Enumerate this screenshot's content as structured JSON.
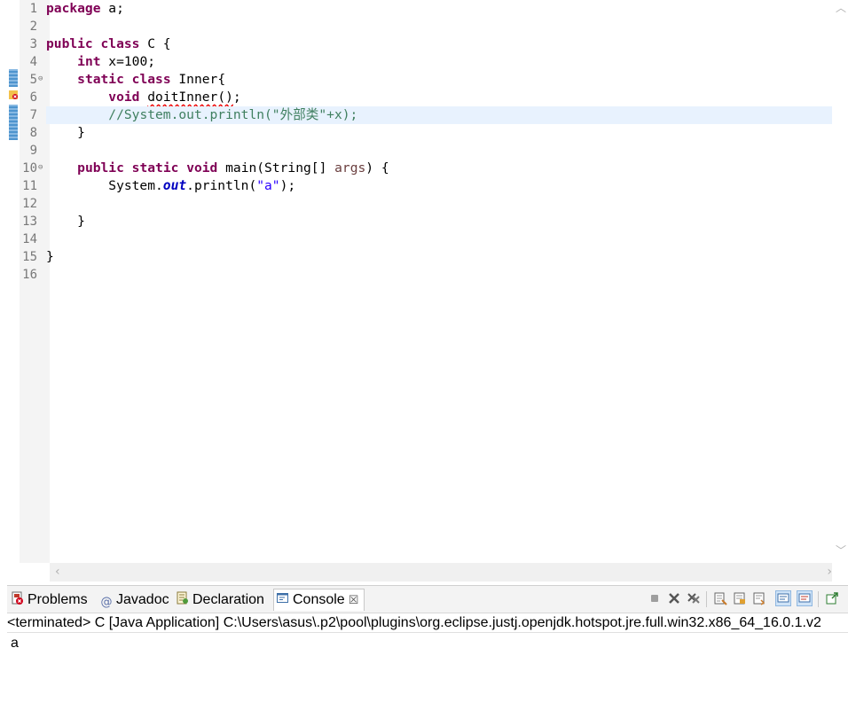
{
  "editor": {
    "lines": [
      {
        "n": "1",
        "tokens": [
          {
            "t": "package",
            "c": "kw"
          },
          {
            "t": " a;",
            "c": ""
          }
        ]
      },
      {
        "n": "2",
        "tokens": []
      },
      {
        "n": "3",
        "tokens": [
          {
            "t": "public",
            "c": "kw"
          },
          {
            "t": " ",
            "c": ""
          },
          {
            "t": "class",
            "c": "kw"
          },
          {
            "t": " C {",
            "c": ""
          }
        ]
      },
      {
        "n": "4",
        "tokens": [
          {
            "t": "    ",
            "c": ""
          },
          {
            "t": "int",
            "c": "kw"
          },
          {
            "t": " x=100;",
            "c": ""
          }
        ]
      },
      {
        "n": "5",
        "fold": true,
        "tokens": [
          {
            "t": "    ",
            "c": ""
          },
          {
            "t": "static",
            "c": "kw"
          },
          {
            "t": " ",
            "c": ""
          },
          {
            "t": "class",
            "c": "kw"
          },
          {
            "t": " Inner{",
            "c": ""
          }
        ]
      },
      {
        "n": "6",
        "tokens": [
          {
            "t": "        ",
            "c": ""
          },
          {
            "t": "void",
            "c": "kw"
          },
          {
            "t": " ",
            "c": ""
          },
          {
            "t": "doitInner()",
            "c": "err"
          },
          {
            "t": ";",
            "c": ""
          }
        ]
      },
      {
        "n": "7",
        "current": true,
        "tokens": [
          {
            "t": "        ",
            "c": ""
          },
          {
            "t": "//System.out.println(\"外部类\"+x);",
            "c": "cm"
          }
        ]
      },
      {
        "n": "8",
        "tokens": [
          {
            "t": "    }",
            "c": ""
          }
        ]
      },
      {
        "n": "9",
        "tokens": []
      },
      {
        "n": "10",
        "fold": true,
        "tokens": [
          {
            "t": "    ",
            "c": ""
          },
          {
            "t": "public",
            "c": "kw"
          },
          {
            "t": " ",
            "c": ""
          },
          {
            "t": "static",
            "c": "kw"
          },
          {
            "t": " ",
            "c": ""
          },
          {
            "t": "void",
            "c": "kw"
          },
          {
            "t": " main(String[] ",
            "c": ""
          },
          {
            "t": "args",
            "c": "var"
          },
          {
            "t": ") {",
            "c": ""
          }
        ]
      },
      {
        "n": "11",
        "tokens": [
          {
            "t": "        System.",
            "c": ""
          },
          {
            "t": "out",
            "c": "fld"
          },
          {
            "t": ".println(",
            "c": ""
          },
          {
            "t": "\"a\"",
            "c": "st"
          },
          {
            "t": ");",
            "c": ""
          }
        ]
      },
      {
        "n": "12",
        "tokens": []
      },
      {
        "n": "13",
        "tokens": [
          {
            "t": "    }",
            "c": ""
          }
        ]
      },
      {
        "n": "14",
        "tokens": []
      },
      {
        "n": "15",
        "tokens": [
          {
            "t": "}",
            "c": ""
          }
        ]
      },
      {
        "n": "16",
        "tokens": []
      }
    ]
  },
  "panel": {
    "tabs": {
      "problems": "Problems",
      "javadoc": "Javadoc",
      "declaration": "Declaration",
      "console": "Console",
      "console_close": "☒"
    },
    "console_header": "<terminated> C [Java Application] C:\\Users\\asus\\.p2\\pool\\plugins\\org.eclipse.justj.openjdk.hotspot.jre.full.win32.x86_64_16.0.1.v2",
    "console_output": "a"
  },
  "icons": {
    "toolbar": [
      "terminate-icon",
      "remove-launch-icon",
      "remove-all-terminated-icon",
      "clear-console-icon",
      "scroll-lock-icon",
      "word-wrap-icon",
      "show-on-stdout-icon",
      "show-on-stderr-icon",
      "pin-console-icon"
    ]
  },
  "colors": {
    "keyword": "#7f0055",
    "comment": "#3f7f5f",
    "string": "#2a00ff",
    "field": "#0000c0",
    "current_line": "#e8f2fe"
  }
}
